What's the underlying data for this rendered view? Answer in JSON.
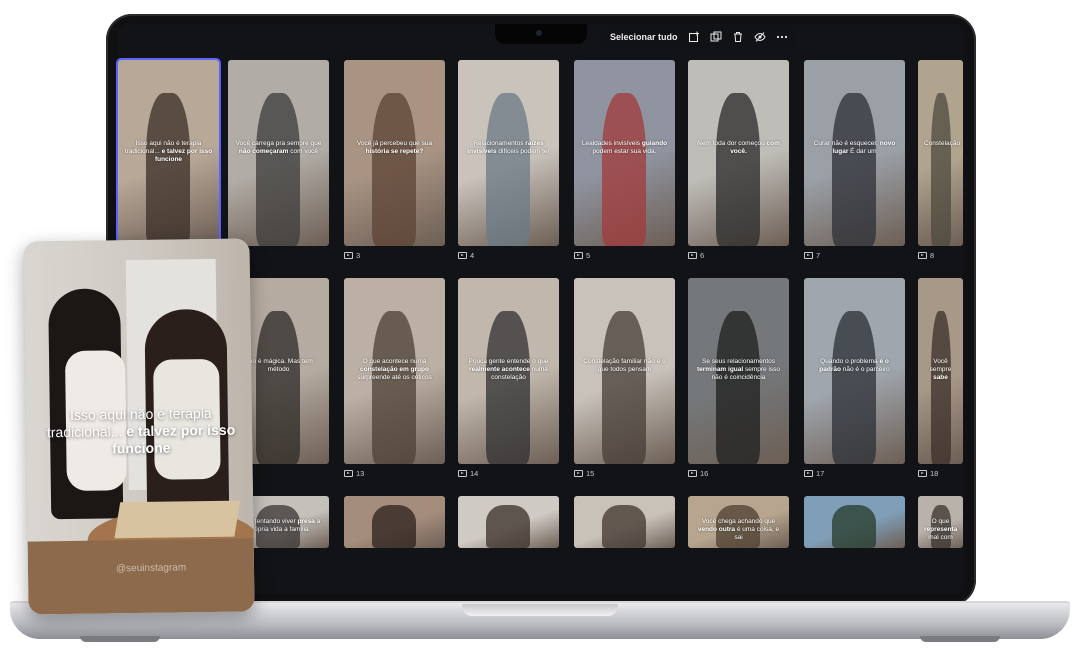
{
  "toolbar": {
    "select_all_label": "Selecionar tudo",
    "icons": [
      "add-icon",
      "duplicate-icon",
      "trash-icon",
      "hide-icon",
      "more-icon"
    ]
  },
  "overlay_card": {
    "text_regular": "Isso aqui não é terapia tradicional...",
    "text_bold": "e talvez por isso funcione",
    "handle": "@seuinstagram"
  },
  "tiles": [
    {
      "id": "1",
      "caption": "",
      "text_a": "Isso aqui não é terapia tradicional...",
      "text_b": "e talvez por isso funcione",
      "text_c": "",
      "bg": "#b8a898",
      "accent": "#3a2d26",
      "selected": true
    },
    {
      "id": "2",
      "caption": "2",
      "text_a": "Você carrega pra sempre que",
      "text_b": "não começaram",
      "text_c": "com você",
      "bg": "#b1aca6",
      "accent": "#3c3b3a",
      "selected": false
    },
    {
      "id": "3",
      "caption": "3",
      "text_a": "Você já percebeu que sua",
      "text_b": "história se repete?",
      "text_c": "",
      "bg": "#a99484",
      "accent": "#5c4334",
      "selected": false
    },
    {
      "id": "4",
      "caption": "4",
      "text_a": "Relacionamentos",
      "text_b": "raízes invisíveis",
      "text_c": "difíceis podem ter",
      "bg": "#c9c3bc",
      "accent": "#6b7a86",
      "selected": false
    },
    {
      "id": "5",
      "caption": "5",
      "text_a": "Lealdades invisíveis",
      "text_b": "guiando",
      "text_c": "podem estar sua vida.",
      "bg": "#8f94a0",
      "accent": "#a23a3a",
      "selected": false
    },
    {
      "id": "6",
      "caption": "6",
      "text_a": "Nem toda dor começou",
      "text_b": "com você.",
      "text_c": "",
      "bg": "#bfbdb8",
      "accent": "#2a2a2a",
      "selected": false
    },
    {
      "id": "7",
      "caption": "7",
      "text_a": "Curar não é esquecer.",
      "text_b": "novo lugar",
      "text_c": "É dar um",
      "bg": "#9aa0a6",
      "accent": "#2c2f35",
      "selected": false
    },
    {
      "id": "8",
      "caption": "8",
      "text_a": "Constelação",
      "text_b": "",
      "text_c": "",
      "bg": "#b0a48f",
      "accent": "#4e4a3e",
      "selected": false
    },
    {
      "id": "12",
      "caption": "",
      "text_a": "Não é mágica.",
      "text_b": "",
      "text_c": "Mas tem método",
      "bg": "#b5aba0",
      "accent": "#2d2a27",
      "selected": false
    },
    {
      "id": "13",
      "caption": "13",
      "text_a": "O que acontece numa",
      "text_b": "constelação em grupo",
      "text_c": "surpreende até os céticos",
      "bg": "#bcb0a5",
      "accent": "#4c4037",
      "selected": false
    },
    {
      "id": "14",
      "caption": "14",
      "text_a": "Pouca gente entende o que",
      "text_b": "realmente acontece",
      "text_c": "numa constelação",
      "bg": "#c1b7ad",
      "accent": "#2f2f31",
      "selected": false
    },
    {
      "id": "15",
      "caption": "15",
      "text_a": "Constelação familiar",
      "text_b": "",
      "text_c": "não é o que todos pensam",
      "bg": "#c8c2ba",
      "accent": "#463c35",
      "selected": false
    },
    {
      "id": "16",
      "caption": "16",
      "text_a": "Se seus relacionamentos",
      "text_b": "terminam igual",
      "text_c": "sempre isso não é coincidência",
      "bg": "#74787a",
      "accent": "#1e1e1e",
      "selected": false
    },
    {
      "id": "17",
      "caption": "17",
      "text_a": "Quando o problema",
      "text_b": "é o padrão",
      "text_c": "não é o parceiro",
      "bg": "#9fa6ad",
      "accent": "#2b2f36",
      "selected": false
    },
    {
      "id": "18",
      "caption": "18",
      "text_a": "Você sempre",
      "text_b": "sabe",
      "text_c": "",
      "bg": "#a89888",
      "accent": "#3b2f29",
      "selected": false
    },
    {
      "id": "20",
      "caption": "",
      "text_a": "gente tentando viver",
      "text_b": "presa",
      "text_c": "a própria vida a família",
      "bg": "#c4c0ba",
      "accent": "#3a3633",
      "selected": false
    },
    {
      "id": "21",
      "caption": "",
      "text_a": "",
      "text_b": "",
      "text_c": "",
      "bg": "#a58d7c",
      "accent": "#2c221c",
      "selected": false
    },
    {
      "id": "22",
      "caption": "",
      "text_a": "",
      "text_b": "",
      "text_c": "",
      "bg": "#d0cac4",
      "accent": "#3a2e28",
      "selected": false
    },
    {
      "id": "23",
      "caption": "",
      "text_a": "",
      "text_b": "",
      "text_c": "",
      "bg": "#c9c2b9",
      "accent": "#3f342d",
      "selected": false
    },
    {
      "id": "24",
      "caption": "",
      "text_a": "Você chega achando que",
      "text_b": "vendo outra",
      "text_c": "é uma coisa, e sai",
      "bg": "#b7a58f",
      "accent": "#4d3f30",
      "selected": false
    },
    {
      "id": "25",
      "caption": "",
      "text_a": "",
      "text_b": "",
      "text_c": "",
      "bg": "#7f9fb9",
      "accent": "#253b2a",
      "selected": false
    },
    {
      "id": "26",
      "caption": "",
      "text_a": "O que",
      "text_b": "representa",
      "text_c": "mal com",
      "bg": "#b9b2aa",
      "accent": "#3a332d",
      "selected": false
    }
  ],
  "colors": {
    "screen_bg": "#121316",
    "selection": "#5a63ff",
    "text": "#ffffff",
    "caption": "#c9c9cc"
  }
}
